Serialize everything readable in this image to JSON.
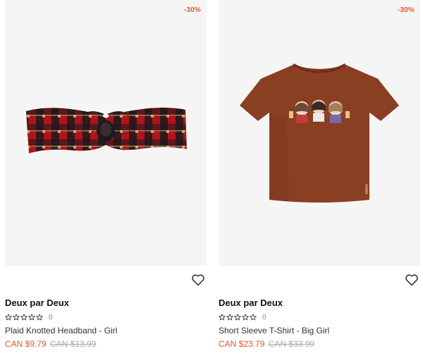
{
  "products": [
    {
      "discount": "-30%",
      "brand": "Deux par Deux",
      "rating_count": "0",
      "name": "Plaid Knotted Headband - Girl",
      "sale_price": "CAN $9.79",
      "original_price": "CAN $13.99",
      "image_icon": "plaid-headband-image"
    },
    {
      "discount": "-30%",
      "brand": "Deux par Deux",
      "rating_count": "0",
      "name": "Short Sleeve T-Shirt - Big Girl",
      "sale_price": "CAN $23.79",
      "original_price": "CAN $33.99",
      "image_icon": "brown-tshirt-image"
    }
  ],
  "colors": {
    "sale": "#e4572e",
    "image_bg": "#f5f5f5",
    "shirt": "#8b3f22"
  }
}
